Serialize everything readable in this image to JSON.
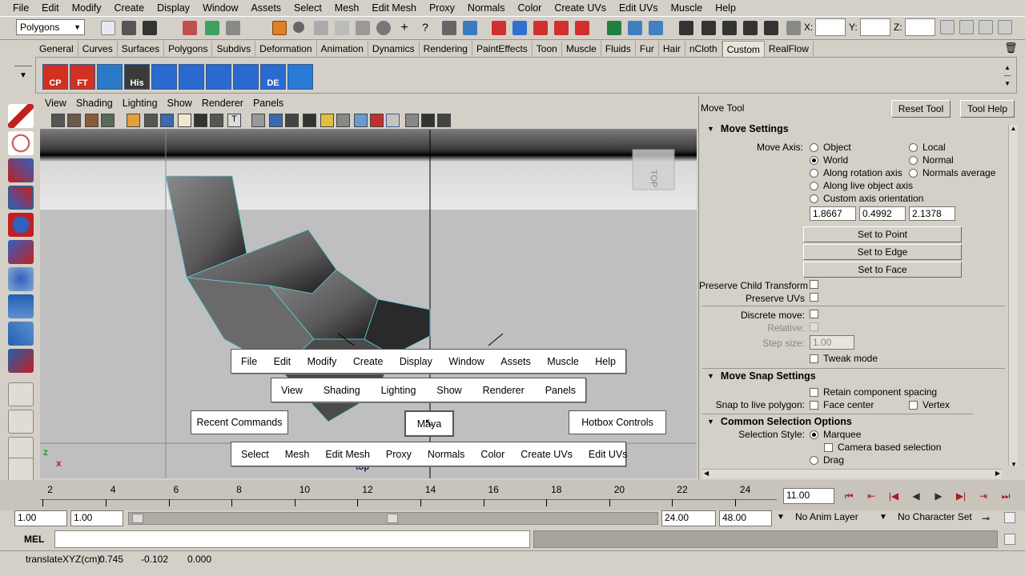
{
  "menubar": [
    "File",
    "Edit",
    "Modify",
    "Create",
    "Display",
    "Window",
    "Assets",
    "Select",
    "Mesh",
    "Edit Mesh",
    "Proxy",
    "Normals",
    "Color",
    "Create UVs",
    "Edit UVs",
    "Muscle",
    "Help"
  ],
  "statusline": {
    "mode": "Polygons",
    "x_label": "X:",
    "y_label": "Y:",
    "z_label": "Z:"
  },
  "shelf_tabs": [
    "General",
    "Curves",
    "Surfaces",
    "Polygons",
    "Subdivs",
    "Deformation",
    "Animation",
    "Dynamics",
    "Rendering",
    "PaintEffects",
    "Toon",
    "Muscle",
    "Fluids",
    "Fur",
    "Hair",
    "nCloth",
    "Custom",
    "RealFlow"
  ],
  "shelf_active_tab": "Custom",
  "shelf_icons": [
    {
      "label": "CP",
      "color": "#d23020"
    },
    {
      "label": "FT",
      "color": "#d23020"
    },
    {
      "label": "",
      "color": "#2a7ac8"
    },
    {
      "label": "His",
      "color": "#3a3a3a"
    },
    {
      "label": "",
      "color": "#2a6ad0"
    },
    {
      "label": "",
      "color": "#2a6ad0"
    },
    {
      "label": "",
      "color": "#2a6ad0"
    },
    {
      "label": "",
      "color": "#2a6ad0"
    },
    {
      "label": "DE",
      "color": "#2a6ad0"
    },
    {
      "label": "",
      "color": "#2a7ad8"
    }
  ],
  "viewport": {
    "menu": [
      "View",
      "Shading",
      "Lighting",
      "Show",
      "Renderer",
      "Panels"
    ],
    "camera_label": "top",
    "axis_z": "z",
    "axis_x": "x",
    "viewcube_label": "TOP"
  },
  "hotbox": {
    "row1": [
      "File",
      "Edit",
      "Modify",
      "Create",
      "Display",
      "Window",
      "Assets",
      "Muscle",
      "Help"
    ],
    "row2": [
      "View",
      "Shading",
      "Lighting",
      "Show",
      "Renderer",
      "Panels"
    ],
    "row3": [
      "Select",
      "Mesh",
      "Edit Mesh",
      "Proxy",
      "Normals",
      "Color",
      "Create UVs",
      "Edit UVs"
    ],
    "recent": "Recent Commands",
    "center": "Maya",
    "controls": "Hotbox Controls"
  },
  "tool_settings": {
    "title": "Move Tool",
    "reset_button": "Reset Tool",
    "help_button": "Tool Help",
    "move_settings": "Move Settings",
    "move_axis_label": "Move Axis:",
    "axis_options_left": [
      "Object",
      "World",
      "Along rotation axis",
      "Along live object axis",
      "Custom axis orientation"
    ],
    "axis_options_right": [
      "Local",
      "Normal",
      "Normals average"
    ],
    "axis_selected": "World",
    "orientation_values": [
      "1.8667",
      "0.4992",
      "2.1378"
    ],
    "set_to_point": "Set to Point",
    "set_to_edge": "Set to Edge",
    "set_to_face": "Set to Face",
    "preserve_child": "Preserve Child Transform",
    "preserve_uvs": "Preserve UVs",
    "discrete_move": "Discrete move:",
    "relative": "Relative:",
    "step_size_label": "Step size:",
    "step_size_value": "1.00",
    "tweak_mode": "Tweak mode",
    "snap_settings": "Move Snap Settings",
    "retain_spacing": "Retain component spacing",
    "snap_live_label": "Snap to live polygon:",
    "face_center": "Face center",
    "vertex": "Vertex",
    "common_selection": "Common Selection Options",
    "selection_style_label": "Selection Style:",
    "marquee": "Marquee",
    "camera_based": "Camera based selection",
    "drag": "Drag"
  },
  "timeline": {
    "ticks": [
      "2",
      "4",
      "6",
      "8",
      "10",
      "12",
      "14",
      "16",
      "18",
      "20",
      "22",
      "24"
    ],
    "current_frame": "11.00"
  },
  "range": {
    "start": "1.00",
    "inner_start": "1.00",
    "inner_end": "24.00",
    "end": "48.00",
    "anim_layer": "No Anim Layer",
    "char_set": "No Character Set"
  },
  "command_line": {
    "label": "MEL"
  },
  "help_line": {
    "label": "translateXYZ(cm):",
    "x": "0.745",
    "y": "-0.102",
    "z": "0.000"
  }
}
